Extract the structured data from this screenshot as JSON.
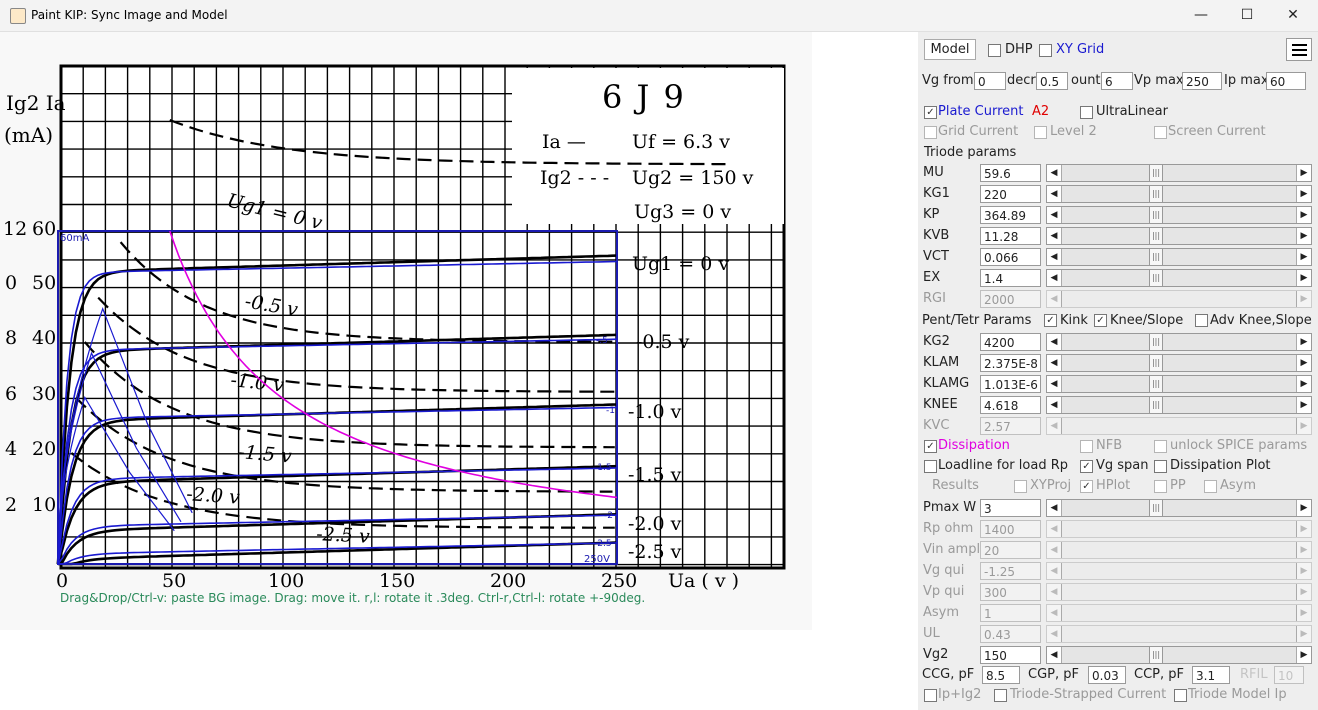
{
  "window": {
    "title": "Paint KIP: Sync Image and Model",
    "minimize": "—",
    "maximize": "☐",
    "close": "✕"
  },
  "scan": {
    "tube": "6 J 9",
    "y_axis_label_1": "Ig2 Ia",
    "y_axis_label_2": "(mA)",
    "x_axis_label": "Ua ( v )",
    "legend_ia": "Ia —",
    "legend_ig2": "Ig2 - - -",
    "uf": "Uf = 6.3 v",
    "ug2": "Ug2 = 150 v",
    "ug3": "Ug3 = 0 v",
    "ug1_top": "Ug1 = 0 v",
    "x_ticks": [
      "0",
      "50",
      "100",
      "150",
      "200",
      "250"
    ],
    "y_ticks_ia": [
      "60",
      "50",
      "40",
      "30",
      "20",
      "10"
    ],
    "y_ticks_ig2": [
      "12",
      "0",
      "8",
      "6",
      "4",
      "2"
    ],
    "right_labels": [
      "Ug1 = 0 v",
      "-0.5 v",
      "-1.0 v",
      "-1.5 v",
      "-2.0 v",
      "-2.5 v"
    ],
    "dash_labels": [
      "-0.5 v",
      "-1.0 v",
      "-1.5 v",
      "-2.0 v",
      "-2.5 v"
    ]
  },
  "chart_data": {
    "type": "line",
    "x_unit": "V",
    "y_unit": "mA",
    "xlim": [
      0,
      250
    ],
    "ylim": [
      0,
      60
    ],
    "box_label": "60mA",
    "box_x_label": "250V",
    "marker_labels": [
      "-.5",
      "-1",
      "-1.5",
      "-2",
      "-2.5"
    ],
    "model_series": [
      {
        "name": "0",
        "plateau": 53.5
      },
      {
        "name": "-.5",
        "plateau": 39.5
      },
      {
        "name": "-1",
        "plateau": 27.2
      },
      {
        "name": "-1.5",
        "plateau": 16.3
      },
      {
        "name": "-2",
        "plateau": 7.8
      },
      {
        "name": "-2.5",
        "plateau": 2.8
      }
    ],
    "pmax_w": 3
  },
  "hint": "Drag&Drop/Ctrl-v: paste BG image. Drag: move it. r,l: rotate it .3deg. Ctrl-r,Ctrl-l: rotate +-90deg.",
  "panel": {
    "model_label": "Model",
    "dhp_label": "DHP",
    "xygrid_label": "XY Grid",
    "vg_from_label": "Vg from",
    "vg_from": "0",
    "decr_label": "decr",
    "decr": "0.5",
    "count_label": "ount",
    "count": "6",
    "vp_max_label": "Vp max",
    "vp_max": "250",
    "ip_max_label": "Ip max",
    "ip_max": "60",
    "plate_current_label": "Plate Current",
    "a2_label": "A2",
    "ultralinear_label": "UltraLinear",
    "grid_current_label": "Grid Current",
    "level2_label": "Level 2",
    "screen_current_label": "Screen Current",
    "triode_params_label": "Triode params",
    "triode_params": [
      {
        "name": "MU",
        "value": "59.6"
      },
      {
        "name": "KG1",
        "value": "220"
      },
      {
        "name": "KP",
        "value": "364.89"
      },
      {
        "name": "KVB",
        "value": "11.28"
      },
      {
        "name": "VCT",
        "value": "0.066"
      },
      {
        "name": "EX",
        "value": "1.4"
      },
      {
        "name": "RGI",
        "value": "2000"
      }
    ],
    "pent_params_label": "Pent/Tetr Params",
    "kink_label": "Kink",
    "knee_slope_label": "Knee/Slope",
    "adv_knee_label": "Adv Knee,Slope",
    "pent_params": [
      {
        "name": "KG2",
        "value": "4200"
      },
      {
        "name": "KLAM",
        "value": "2.375E-8"
      },
      {
        "name": "KLAMG",
        "value": "1.013E-6"
      },
      {
        "name": "KNEE",
        "value": "4.618"
      },
      {
        "name": "KVC",
        "value": "2.57"
      }
    ],
    "dissipation_label": "Dissipation",
    "nfb_label": "NFB",
    "unlock_spice_label": "unlock SPICE params",
    "loadline_label": "Loadline for load Rp",
    "vg_span_label": "Vg span",
    "dissipation_plot_label": "Dissipation Plot",
    "results_label": "Results",
    "xyproj_label": "XYProj",
    "hplot_label": "HPlot",
    "pp_label": "PP",
    "asym_check_label": "Asym",
    "amp_params": [
      {
        "name": "Pmax W",
        "value": "3"
      },
      {
        "name": "Rp ohm",
        "value": "1400"
      },
      {
        "name": "Vin ampl",
        "value": "20"
      },
      {
        "name": "Vg qui",
        "value": "-1.25"
      },
      {
        "name": "Vp qui",
        "value": "300"
      },
      {
        "name": "Asym",
        "value": "1"
      },
      {
        "name": "UL",
        "value": "0.43"
      },
      {
        "name": "Vg2",
        "value": "150"
      }
    ],
    "ccg_label": "CCG, pF",
    "ccg": "8.5",
    "cgp_label": "CGP, pF",
    "cgp": "0.03",
    "ccp_label": "CCP, pF",
    "ccp": "3.1",
    "rfil_label": "RFIL",
    "rfil": "10",
    "ip_ig2_label": "Ip+Ig2",
    "triode_strapped_label": "Triode-Strapped Current",
    "triode_model_label": "Triode Model Ip",
    "colors": {
      "blue": "#1a1ad0",
      "red": "#e00000",
      "magenta": "#e000e0",
      "disabled": "#9a9a9a"
    }
  }
}
